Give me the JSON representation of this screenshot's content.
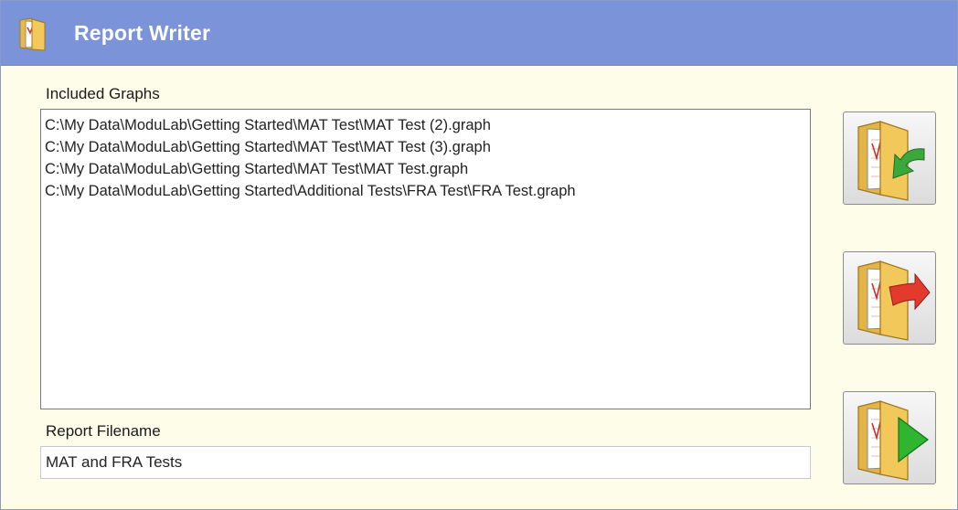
{
  "window": {
    "title": "Report Writer",
    "title_icon": "folder-report-icon",
    "colors": {
      "titlebar": "#7b93d9",
      "background": "#fdfdea"
    }
  },
  "included_graphs": {
    "label": "Included Graphs",
    "items": [
      "C:\\My Data\\ModuLab\\Getting Started\\MAT Test\\MAT Test (2).graph",
      "C:\\My Data\\ModuLab\\Getting Started\\MAT Test\\MAT Test (3).graph",
      "C:\\My Data\\ModuLab\\Getting Started\\MAT Test\\MAT Test.graph",
      "C:\\My Data\\ModuLab\\Getting Started\\Additional Tests\\FRA Test\\FRA Test.graph"
    ]
  },
  "report_filename": {
    "label": "Report Filename",
    "value": "MAT and FRA Tests"
  },
  "buttons": [
    {
      "icon": "add-graph-folder-icon",
      "arrow_color": "#3aa83a"
    },
    {
      "icon": "remove-graph-folder-icon",
      "arrow_color": "#e23b2e"
    },
    {
      "icon": "run-report-folder-icon",
      "arrow_color": "#2fb52f"
    }
  ]
}
